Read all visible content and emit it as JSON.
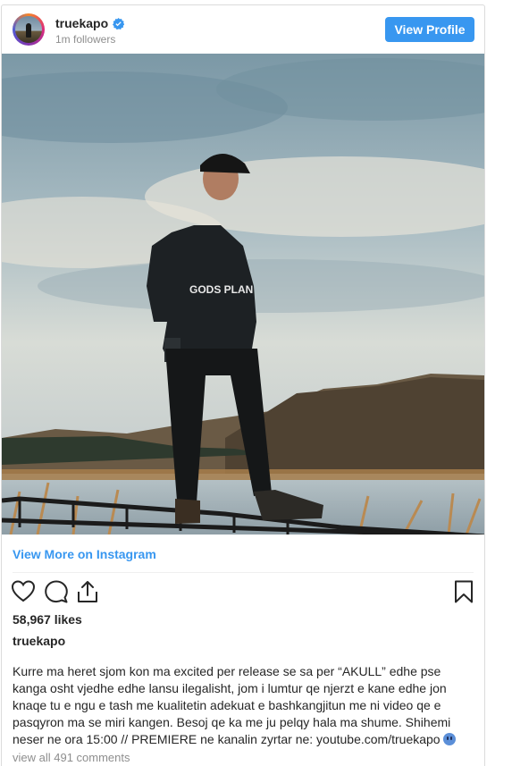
{
  "profile": {
    "username": "truekapo",
    "followers": "1m followers",
    "view_profile_label": "View Profile"
  },
  "links": {
    "view_more": "View More on Instagram"
  },
  "post": {
    "likes": "58,967 likes",
    "username": "truekapo",
    "caption": "Kurre ma heret sjom kon ma excited per release se sa per “AKULL” edhe pse kanga osht vjedhe edhe lansu ilegalisht, jom i lumtur qe njerzt e kane edhe jon knaqe tu e ngu e tash me kualitetin adekuat e bashkangjitun me ni video qe e pasqyron ma se miri kangen. Besoj qe ka me ju pelqy hala ma shume. Shihemi neser ne ora 15:00 // PREMIERE ne kanalin zyrtar ne: youtube.com/truekapo",
    "view_comments": "view all 491 comments",
    "hoodie_text": "GODS PLAN"
  },
  "icons": {
    "verified": "verified-badge-icon",
    "like": "heart-icon",
    "comment": "comment-bubble-icon",
    "share": "share-icon",
    "save": "bookmark-icon",
    "caption_emoji": "ice-face-emoji"
  },
  "colors": {
    "accent": "#3897f0",
    "text": "#262626",
    "muted": "#8e8e8e",
    "border": "#dbdbdb"
  }
}
